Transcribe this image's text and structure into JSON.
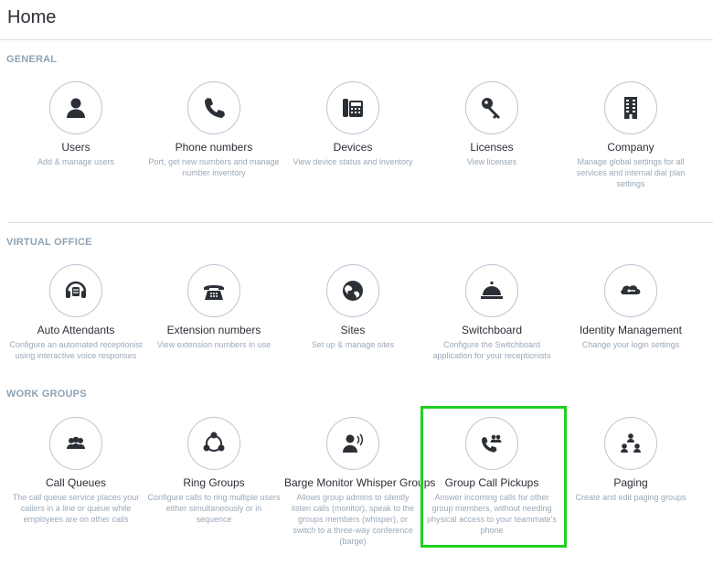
{
  "page": {
    "title": "Home"
  },
  "sections": {
    "general": {
      "heading": "GENERAL",
      "tiles": [
        {
          "title": "Users",
          "desc": "Add & manage users",
          "icon": "user-icon"
        },
        {
          "title": "Phone numbers",
          "desc": "Port, get new numbers and manage number inventory",
          "icon": "phone-icon"
        },
        {
          "title": "Devices",
          "desc": "View device status and inventory",
          "icon": "desk-phone-icon"
        },
        {
          "title": "Licenses",
          "desc": "View licenses",
          "icon": "key-icon"
        },
        {
          "title": "Company",
          "desc": "Manage global settings for all services and internal dial plan settings",
          "icon": "building-icon"
        }
      ]
    },
    "virtual_office": {
      "heading": "VIRTUAL OFFICE",
      "tiles": [
        {
          "title": "Auto Attendants",
          "desc": "Configure an automated receptionist using interactive voice responses",
          "icon": "headset-icon"
        },
        {
          "title": "Extension numbers",
          "desc": "View extension numbers in use",
          "icon": "rotary-phone-icon"
        },
        {
          "title": "Sites",
          "desc": "Set up & manage sites",
          "icon": "globe-icon"
        },
        {
          "title": "Switchboard",
          "desc": "Configure the Switchboard application for your receptionists",
          "icon": "service-bell-icon"
        },
        {
          "title": "Identity Management",
          "desc": "Change your login settings",
          "icon": "identity-icon"
        }
      ]
    },
    "work_groups": {
      "heading": "WORK GROUPS",
      "tiles": [
        {
          "title": "Call Queues",
          "desc": "The call queue service places your callers in a line or queue while employees are on other calls",
          "icon": "users-icon"
        },
        {
          "title": "Ring Groups",
          "desc": "Configure calls to ring multiple users either simultaneously or in sequence",
          "icon": "ring-group-icon"
        },
        {
          "title": "Barge Monitor Whisper Groups",
          "desc": "Allows group admins to silently listen calls (monitor), speak to the groups members (whisper), or switch to a three-way conference (barge)",
          "icon": "whisper-icon"
        },
        {
          "title": "Group Call Pickups",
          "desc": "Answer incoming calls for other group members, without needing physical access to your teammate's phone",
          "icon": "call-pickup-icon"
        },
        {
          "title": "Paging",
          "desc": "Create and edit paging groups",
          "icon": "org-chart-icon"
        }
      ]
    }
  },
  "colors": {
    "highlight": "#1fd11f",
    "icon": "#2b2f36",
    "heading": "#8fa3b5",
    "desc": "#9aa9b8"
  }
}
